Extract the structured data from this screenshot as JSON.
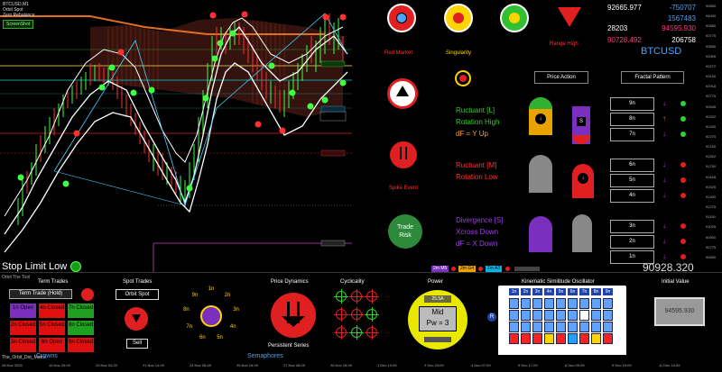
{
  "chart": {
    "title_lines": [
      "BTCUSD,M1",
      "Orbit Spot",
      "Zero Rebalance"
    ],
    "screenshot_btn": "ScreenShot",
    "top_price_labels": [
      {
        "value": "92665.977",
        "color": "#ffffff"
      },
      {
        "value": "-750707",
        "color": "#4aa3ff"
      },
      {
        "value": "1567483",
        "color": "#4aa3ff"
      }
    ],
    "mid_price_labels": [
      {
        "value": "28203",
        "color": "#ffffff"
      },
      {
        "value": "94595.930",
        "color": "#ff3a7a"
      }
    ],
    "low_price_labels": [
      {
        "value": "90728.492",
        "color": "#ff3a7a"
      },
      {
        "value": "206758",
        "color": "#ffffff"
      }
    ],
    "corner_tag": "Orbit The Tool",
    "right_axis": [
      "95550",
      "94000",
      "93880",
      "93775",
      "93650",
      "93395",
      "93272",
      "93150",
      "92918",
      "92775",
      "92645",
      "92522",
      "92400",
      "92275",
      "92150",
      "91922",
      "91750",
      "91628",
      "91525",
      "91400",
      "91275",
      "91150",
      "91025",
      "90900",
      "90775",
      "90650"
    ],
    "status_text": "Stop Limit Low",
    "big_price": "90928.320",
    "bottom_date_axis": [
      "28 Nov 2025",
      "18 Nov 20:09",
      "20 Nov 04:33",
      "21 Nov 14:09",
      "24 Nov 06:45",
      "25 Nov 16:09",
      "27 Nov 08:09",
      "28 Nov 18:09",
      "1 Dec 10:09",
      "2 Dec 20:09",
      "4 Dec 07:09",
      "5 Dec 17:09",
      "8 Dec 09:09",
      "9 Dec 19:09",
      "11 Dec 10:09"
    ],
    "window_tab": "The_Orbit_Dot_Matrix",
    "crowns_label": "Crowns",
    "semaphores_label": "Semaphores",
    "ticker_labels": [
      "1m",
      "2m",
      "3m",
      "4m",
      "5m",
      "6m",
      "7m",
      "8m",
      "9m",
      "1m",
      "2m",
      "3m",
      "4m",
      "5m",
      "6m",
      "7m",
      "8m",
      "9m"
    ],
    "legend_tags": [
      {
        "label": "2m M5",
        "color": "#7b2fbe"
      },
      {
        "label": "2m G4",
        "color": "#e8a300"
      },
      {
        "label": "2m A3",
        "color": "#00b7e8"
      }
    ]
  },
  "signals": {
    "top_row": [
      {
        "label": "Red Market",
        "color": "#ff3030"
      },
      {
        "label": "Singularity",
        "color": "#ffd400"
      },
      {
        "label": "",
        "color": "#ff3030"
      },
      {
        "label": "Range High",
        "color": "#ff3030"
      }
    ],
    "symbol": "BTCUSD",
    "price_action_btn": "Price Action",
    "fractal_pattern_btn": "Fractal Pattern",
    "green_lines": [
      "Ructuant [L]",
      "Rotation High",
      "dF = Y Up"
    ],
    "red_lines": [
      "Ructuant [M]",
      "Rotation Low"
    ],
    "purple_lines": [
      "Divergence [S]",
      "Xcross Down",
      "dF = X Down"
    ],
    "spike_label": "Spike Event",
    "trade_risk": [
      "Trade",
      "Risk"
    ],
    "box_groups": [
      [
        "9n",
        "8n",
        "7n"
      ],
      [
        "6n",
        "5n",
        "4n"
      ],
      [
        "3n",
        "2n",
        "1n"
      ]
    ]
  },
  "bottom": {
    "term_trades": {
      "title": "Term Trades",
      "btn": "Term Trade (Hold)",
      "cells": [
        {
          "label": "1n Open",
          "color": "#7b2fbe"
        },
        {
          "label": "4n Closed",
          "color": "#e01010"
        },
        {
          "label": "7n Closed",
          "color": "#20a020"
        },
        {
          "label": "2n Closed",
          "color": "#e01010"
        },
        {
          "label": "5n Closed",
          "color": "#e01010"
        },
        {
          "label": "8n Closed",
          "color": "#20a020"
        },
        {
          "label": "3n Closed",
          "color": "#e01010"
        },
        {
          "label": "6n Open",
          "color": "#e01010"
        },
        {
          "label": "9n Closed",
          "color": "#e01010"
        }
      ]
    },
    "spot_trades": {
      "title": "Spot Trades",
      "btn": "Orbit Spot",
      "sell": "Sell"
    },
    "price_dynamics": {
      "title": "Price Dynamics",
      "label": "Persistent Series"
    },
    "cyclicality": {
      "title": "Cyclicality"
    },
    "power": {
      "title": "Power",
      "value": "25.5A",
      "mid": "Mid",
      "pw": "Pw = 3"
    },
    "ksd": {
      "title": "Kinematic Similitude Oscillator",
      "headers": [
        "1n",
        "2n",
        "3n",
        "4n",
        "5n",
        "6n",
        "7n",
        "8n",
        "9n"
      ],
      "left_label": "R",
      "bottom_colors": [
        "#ff2020",
        "#ff2020",
        "#ff2020",
        "#ffd400",
        "#ff2020",
        "#20a0ff",
        "#ff2020",
        "#ffd400",
        "#ff2020"
      ]
    },
    "initial_value": {
      "title": "Initial Value",
      "value": "94595.930"
    }
  },
  "orbit_numbers": [
    "1n",
    "2n",
    "3n",
    "4n",
    "5n",
    "6n",
    "7n",
    "8n",
    "9n"
  ]
}
